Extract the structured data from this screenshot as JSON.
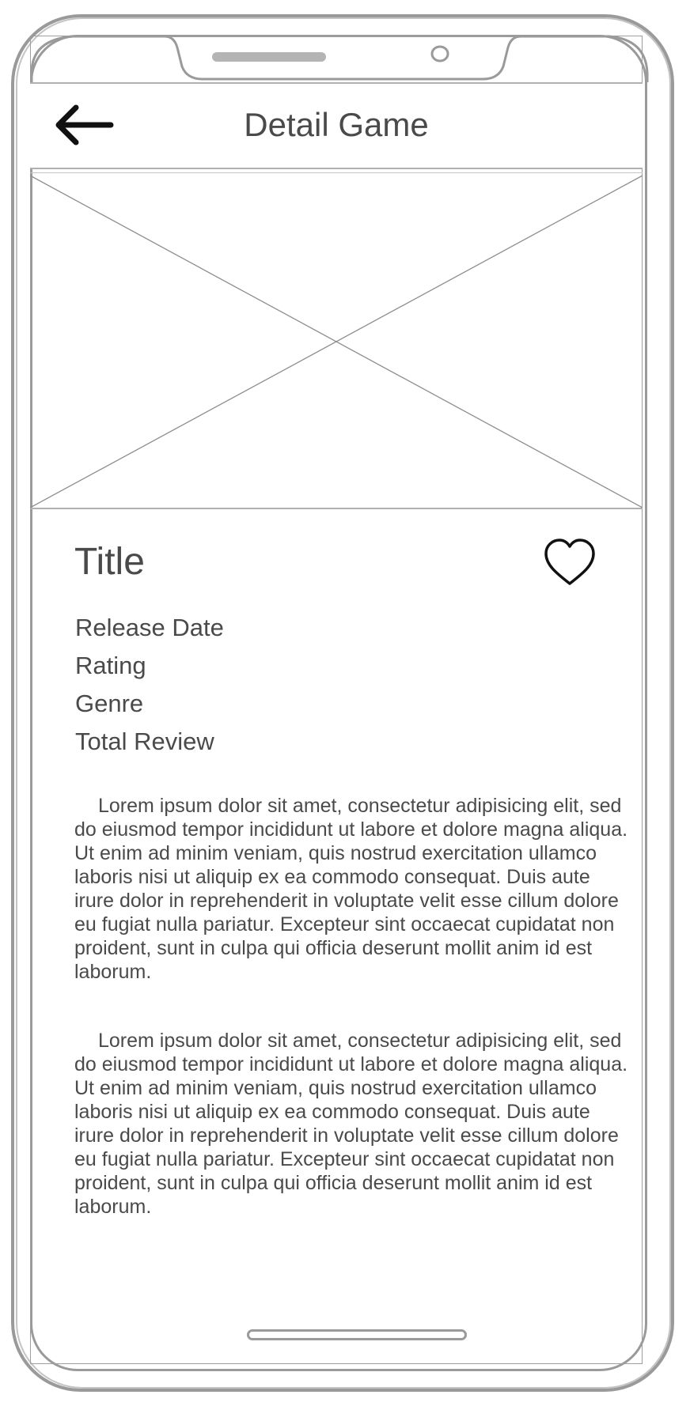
{
  "app_bar": {
    "title": "Detail Game",
    "back_icon": "arrow-left-icon"
  },
  "hero": {
    "placeholder": "image-placeholder"
  },
  "details": {
    "title": "Title",
    "favorite_icon": "heart-outline-icon",
    "meta": [
      "Release Date",
      "Rating",
      "Genre",
      "Total Review"
    ],
    "descriptions": [
      "Lorem ipsum dolor sit amet, consectetur adipisicing elit, sed do eiusmod tempor incididunt ut labore et dolore magna aliqua. Ut enim ad minim veniam, quis nostrud exercitation ullamco laboris nisi ut aliquip ex ea commodo consequat. Duis aute irure dolor in reprehenderit in voluptate velit esse cillum dolore eu fugiat nulla pariatur. Excepteur sint occaecat cupidatat non proident, sunt in culpa qui officia deserunt mollit anim id est laborum.",
      "Lorem ipsum dolor sit amet, consectetur adipisicing elit, sed do eiusmod tempor incididunt ut labore et dolore magna aliqua. Ut enim ad minim veniam, quis nostrud exercitation ullamco laboris nisi ut aliquip ex ea commodo consequat. Duis aute irure dolor in reprehenderit in voluptate velit esse cillum dolore eu fugiat nulla pariatur. Excepteur sint occaecat cupidatat non proident, sunt in culpa qui officia deserunt mollit anim id est laborum."
    ]
  },
  "colors": {
    "sketch_stroke": "#9a9a9a",
    "text": "#4a4a4a"
  }
}
